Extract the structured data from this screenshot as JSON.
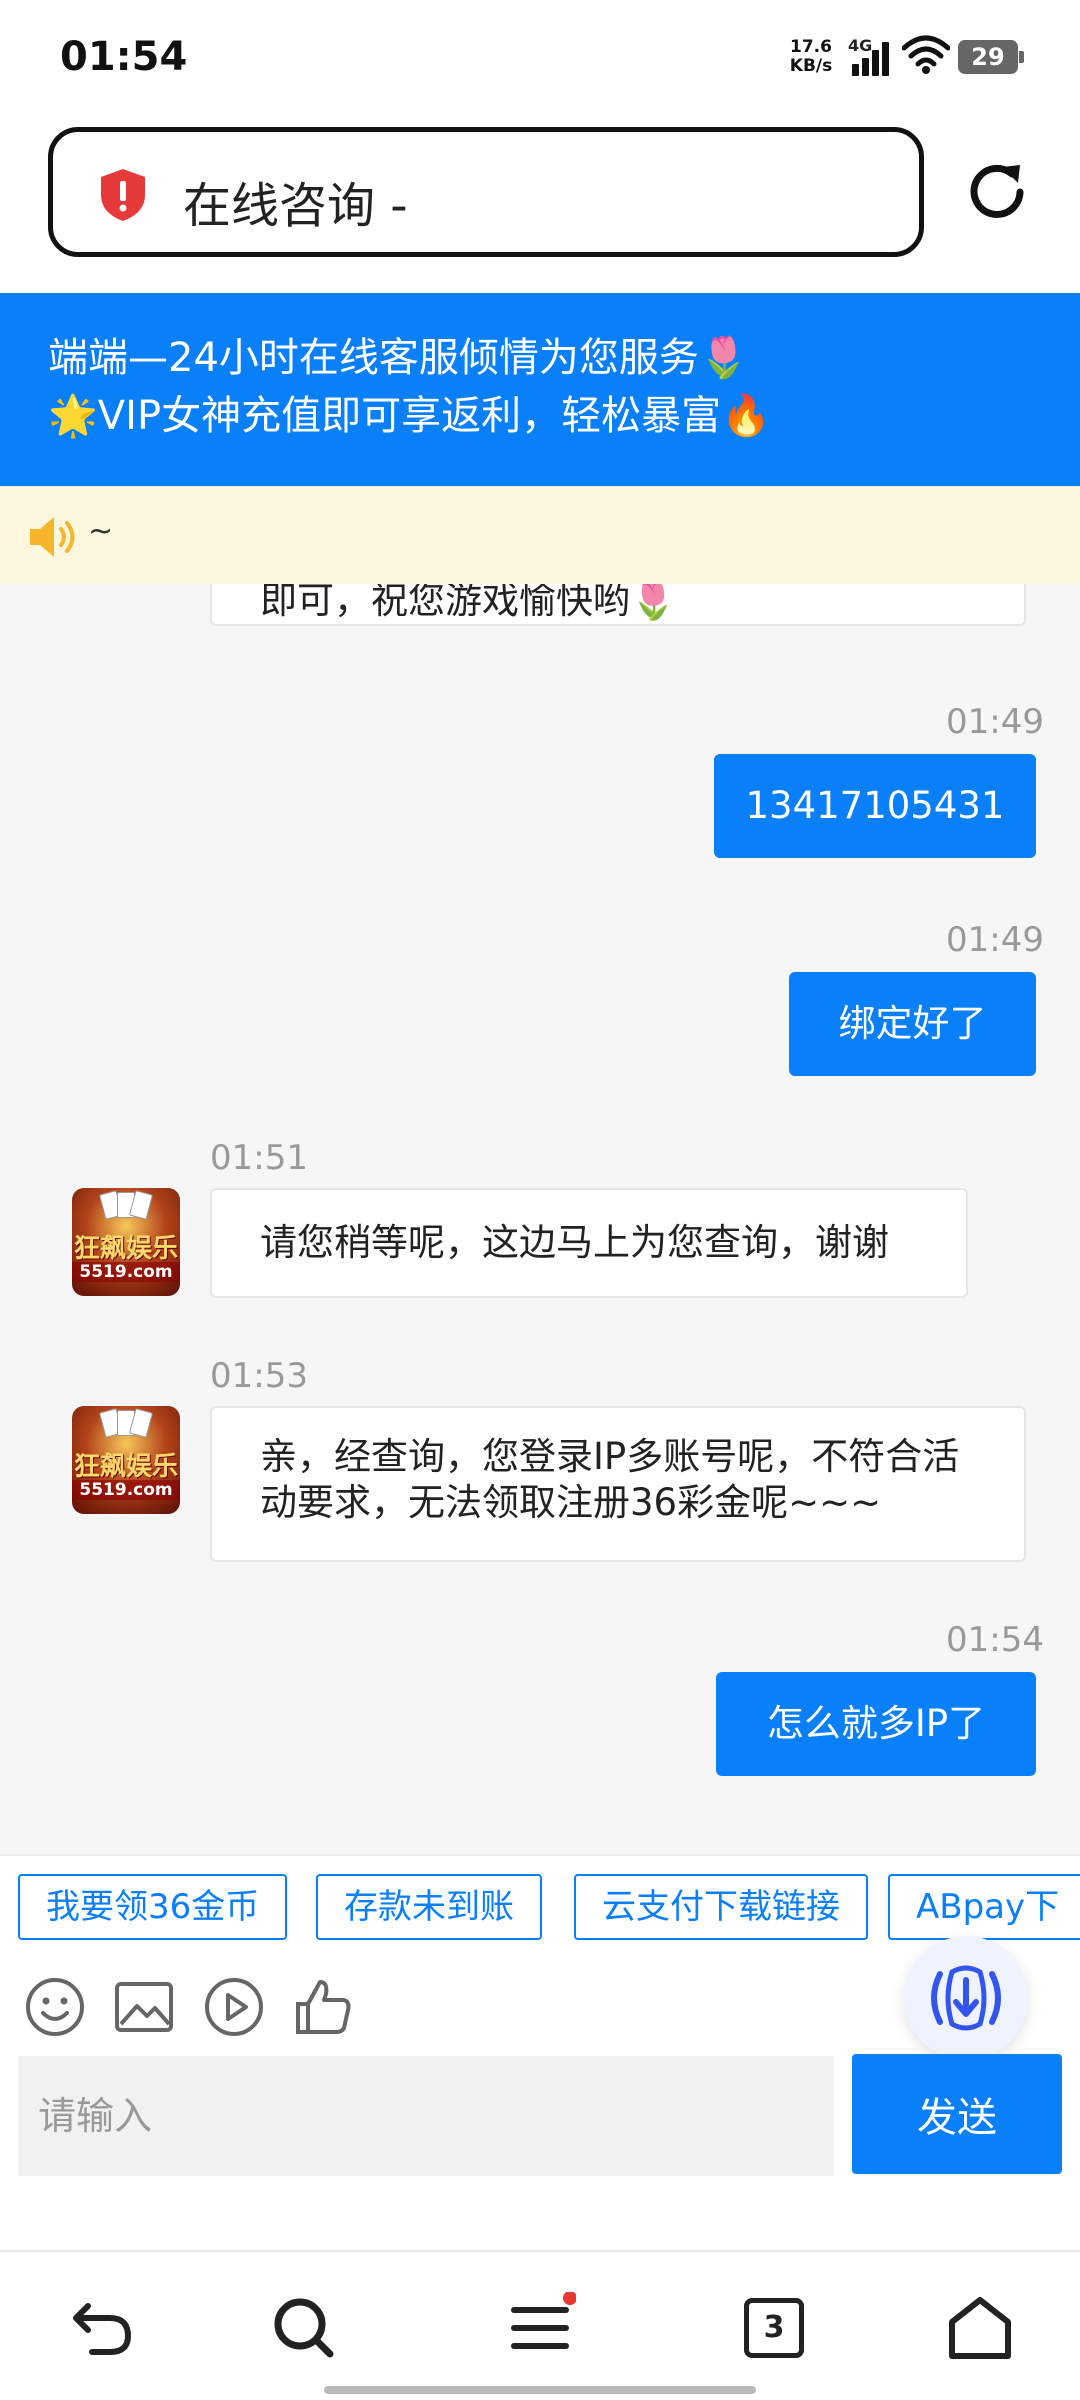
{
  "status_bar": {
    "time": "01:54",
    "net_speed_value": "17.6",
    "net_speed_unit": "KB/s",
    "network": "4G",
    "battery": "29"
  },
  "url_bar": {
    "title": "在线咨询 -",
    "security_icon": "shield-alert-icon",
    "reload_icon": "reload-icon"
  },
  "banner": {
    "line1": "端端—24小时在线客服倾情为您服务🌷",
    "line2": "🌟VIP女神充值即可享返利，轻松暴富🔥"
  },
  "notice": {
    "icon": "speaker-icon",
    "text": "~"
  },
  "chat": {
    "messages": [
      {
        "from": "agent",
        "time": "",
        "text": "即可，祝您游戏愉快哟🌷"
      },
      {
        "from": "me",
        "time": "01:49",
        "text": "13417105431"
      },
      {
        "from": "me",
        "time": "01:49",
        "text": "绑定好了"
      },
      {
        "from": "agent",
        "time": "01:51",
        "text": "请您稍等呢，这边马上为您查询，谢谢"
      },
      {
        "from": "agent",
        "time": "01:53",
        "text": "亲，经查询，您登录IP多账号呢，不符合活动要求，无法领取注册36彩金呢~~~"
      },
      {
        "from": "me",
        "time": "01:54",
        "text": "怎么就多IP了"
      }
    ],
    "agent_avatar_logo": "狂飙娱乐",
    "agent_avatar_domain": "5519.com"
  },
  "quick_replies": [
    "我要领36金币",
    "存款未到账",
    "云支付下载链接",
    "ABpay下"
  ],
  "tools": [
    "emoji-icon",
    "image-icon",
    "video-icon",
    "thumbs-up-icon"
  ],
  "input": {
    "placeholder": "请输入",
    "send_label": "发送"
  },
  "bottom_nav": {
    "items": [
      "back-icon",
      "search-icon",
      "menu-icon",
      "tabs-icon",
      "home-icon"
    ],
    "tabs_count": "3"
  },
  "colors": {
    "accent": "#0a7ffa",
    "notice_bg": "#fdf7dd",
    "chat_bg": "#f6f6f6"
  }
}
